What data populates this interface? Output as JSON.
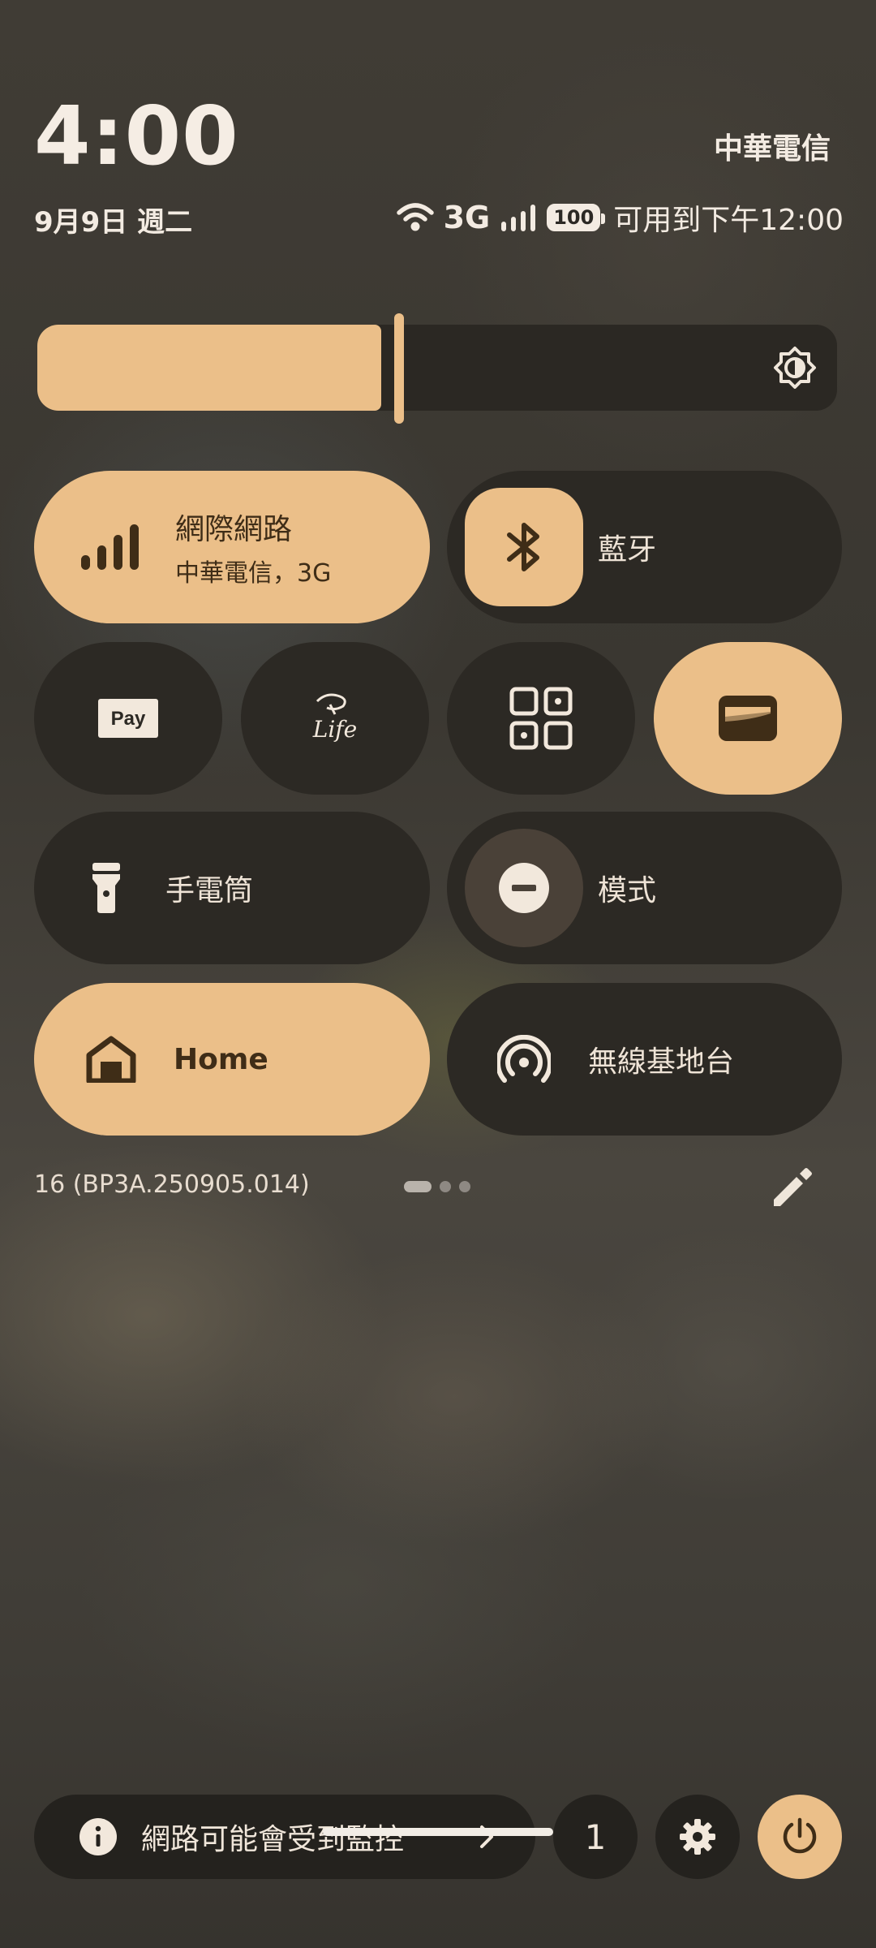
{
  "status": {
    "time": "4:00",
    "carrier": "中華電信",
    "date": "9月9日 週二",
    "network_type": "3G",
    "battery_level": "100",
    "battery_text": "可用到下午12:00",
    "icons": [
      "wifi-icon",
      "signal-icon",
      "battery-icon"
    ]
  },
  "brightness": {
    "level_fraction": 0.43,
    "icon": "brightness-icon"
  },
  "tiles": {
    "internet": {
      "title": "網際網路",
      "subtitle": "中華電信，3G",
      "active": true,
      "icon": "signal-bars-icon"
    },
    "bluetooth": {
      "label": "藍牙",
      "active": true,
      "icon": "bluetooth-icon"
    },
    "pay": {
      "badge": "Pay",
      "active": false,
      "icon": "pay-icon"
    },
    "life": {
      "badge": "Life",
      "active": false,
      "icon": "life-app-icon"
    },
    "qr": {
      "active": false,
      "icon": "qr-scanner-icon"
    },
    "wallet": {
      "active": true,
      "icon": "wallet-icon"
    },
    "flashlight": {
      "label": "手電筒",
      "active": false,
      "icon": "flashlight-icon"
    },
    "modes": {
      "label": "模式",
      "active": false,
      "icon": "do-not-disturb-icon"
    },
    "home": {
      "label": "Home",
      "active": true,
      "icon": "home-icon"
    },
    "hotspot": {
      "label": "無線基地台",
      "active": false,
      "icon": "hotspot-icon"
    }
  },
  "footer": {
    "build": "16 (BP3A.250905.014)",
    "page_indicator": {
      "pages": 3,
      "current": 1
    },
    "edit_icon": "pencil-icon"
  },
  "bottom": {
    "monitor_label": "網路可能會受到監控",
    "user_count": "1",
    "colors": {
      "accent": "#ebbf89",
      "tile_dark": "#2c2924",
      "on_accent": "#3f2d17"
    }
  }
}
